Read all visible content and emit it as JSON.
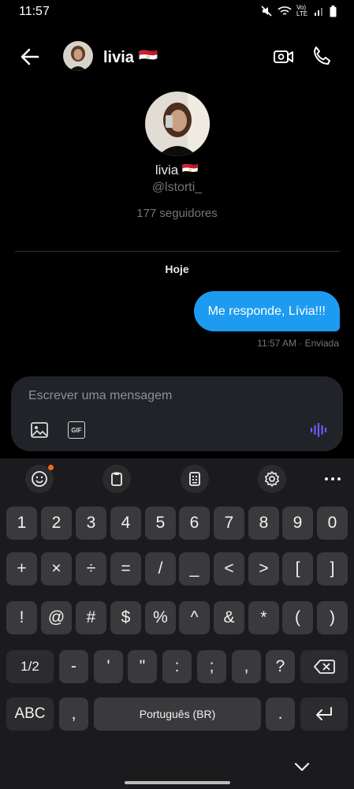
{
  "status_bar": {
    "time": "11:57",
    "network_label": "Vo) LTE"
  },
  "header": {
    "name": "livia 🇪🇬"
  },
  "profile": {
    "name": "livia 🇪🇬",
    "handle": "@lstorti_",
    "followers": "177 seguidores"
  },
  "conversation": {
    "date_label": "Hoje",
    "messages": [
      {
        "text": "Me responde, Lívia!!!",
        "meta": "11:57 AM · Enviada",
        "direction": "outgoing"
      }
    ]
  },
  "composer": {
    "placeholder": "Escrever uma mensagem",
    "gif_label": "GIF"
  },
  "keyboard": {
    "toolbar_icons": [
      "emoji-icon",
      "clipboard-icon",
      "keypad-icon",
      "settings-icon",
      "more-icon"
    ],
    "rows": [
      [
        "1",
        "2",
        "3",
        "4",
        "5",
        "6",
        "7",
        "8",
        "9",
        "0"
      ],
      [
        "+",
        "×",
        "÷",
        "=",
        "/",
        "_",
        "<",
        ">",
        "[",
        "]"
      ],
      [
        "!",
        "@",
        "#",
        "$",
        "%",
        "^",
        "&",
        "*",
        "(",
        ")"
      ],
      [
        "1/2",
        "-",
        "'",
        "\"",
        ":",
        ";",
        ",",
        "?",
        "⌫"
      ],
      [
        "ABC",
        ",",
        "Português (BR)",
        ".",
        "↵"
      ]
    ]
  },
  "colors": {
    "accent": "#1d9bf0",
    "background": "#000000",
    "voice": "#7856ff"
  }
}
